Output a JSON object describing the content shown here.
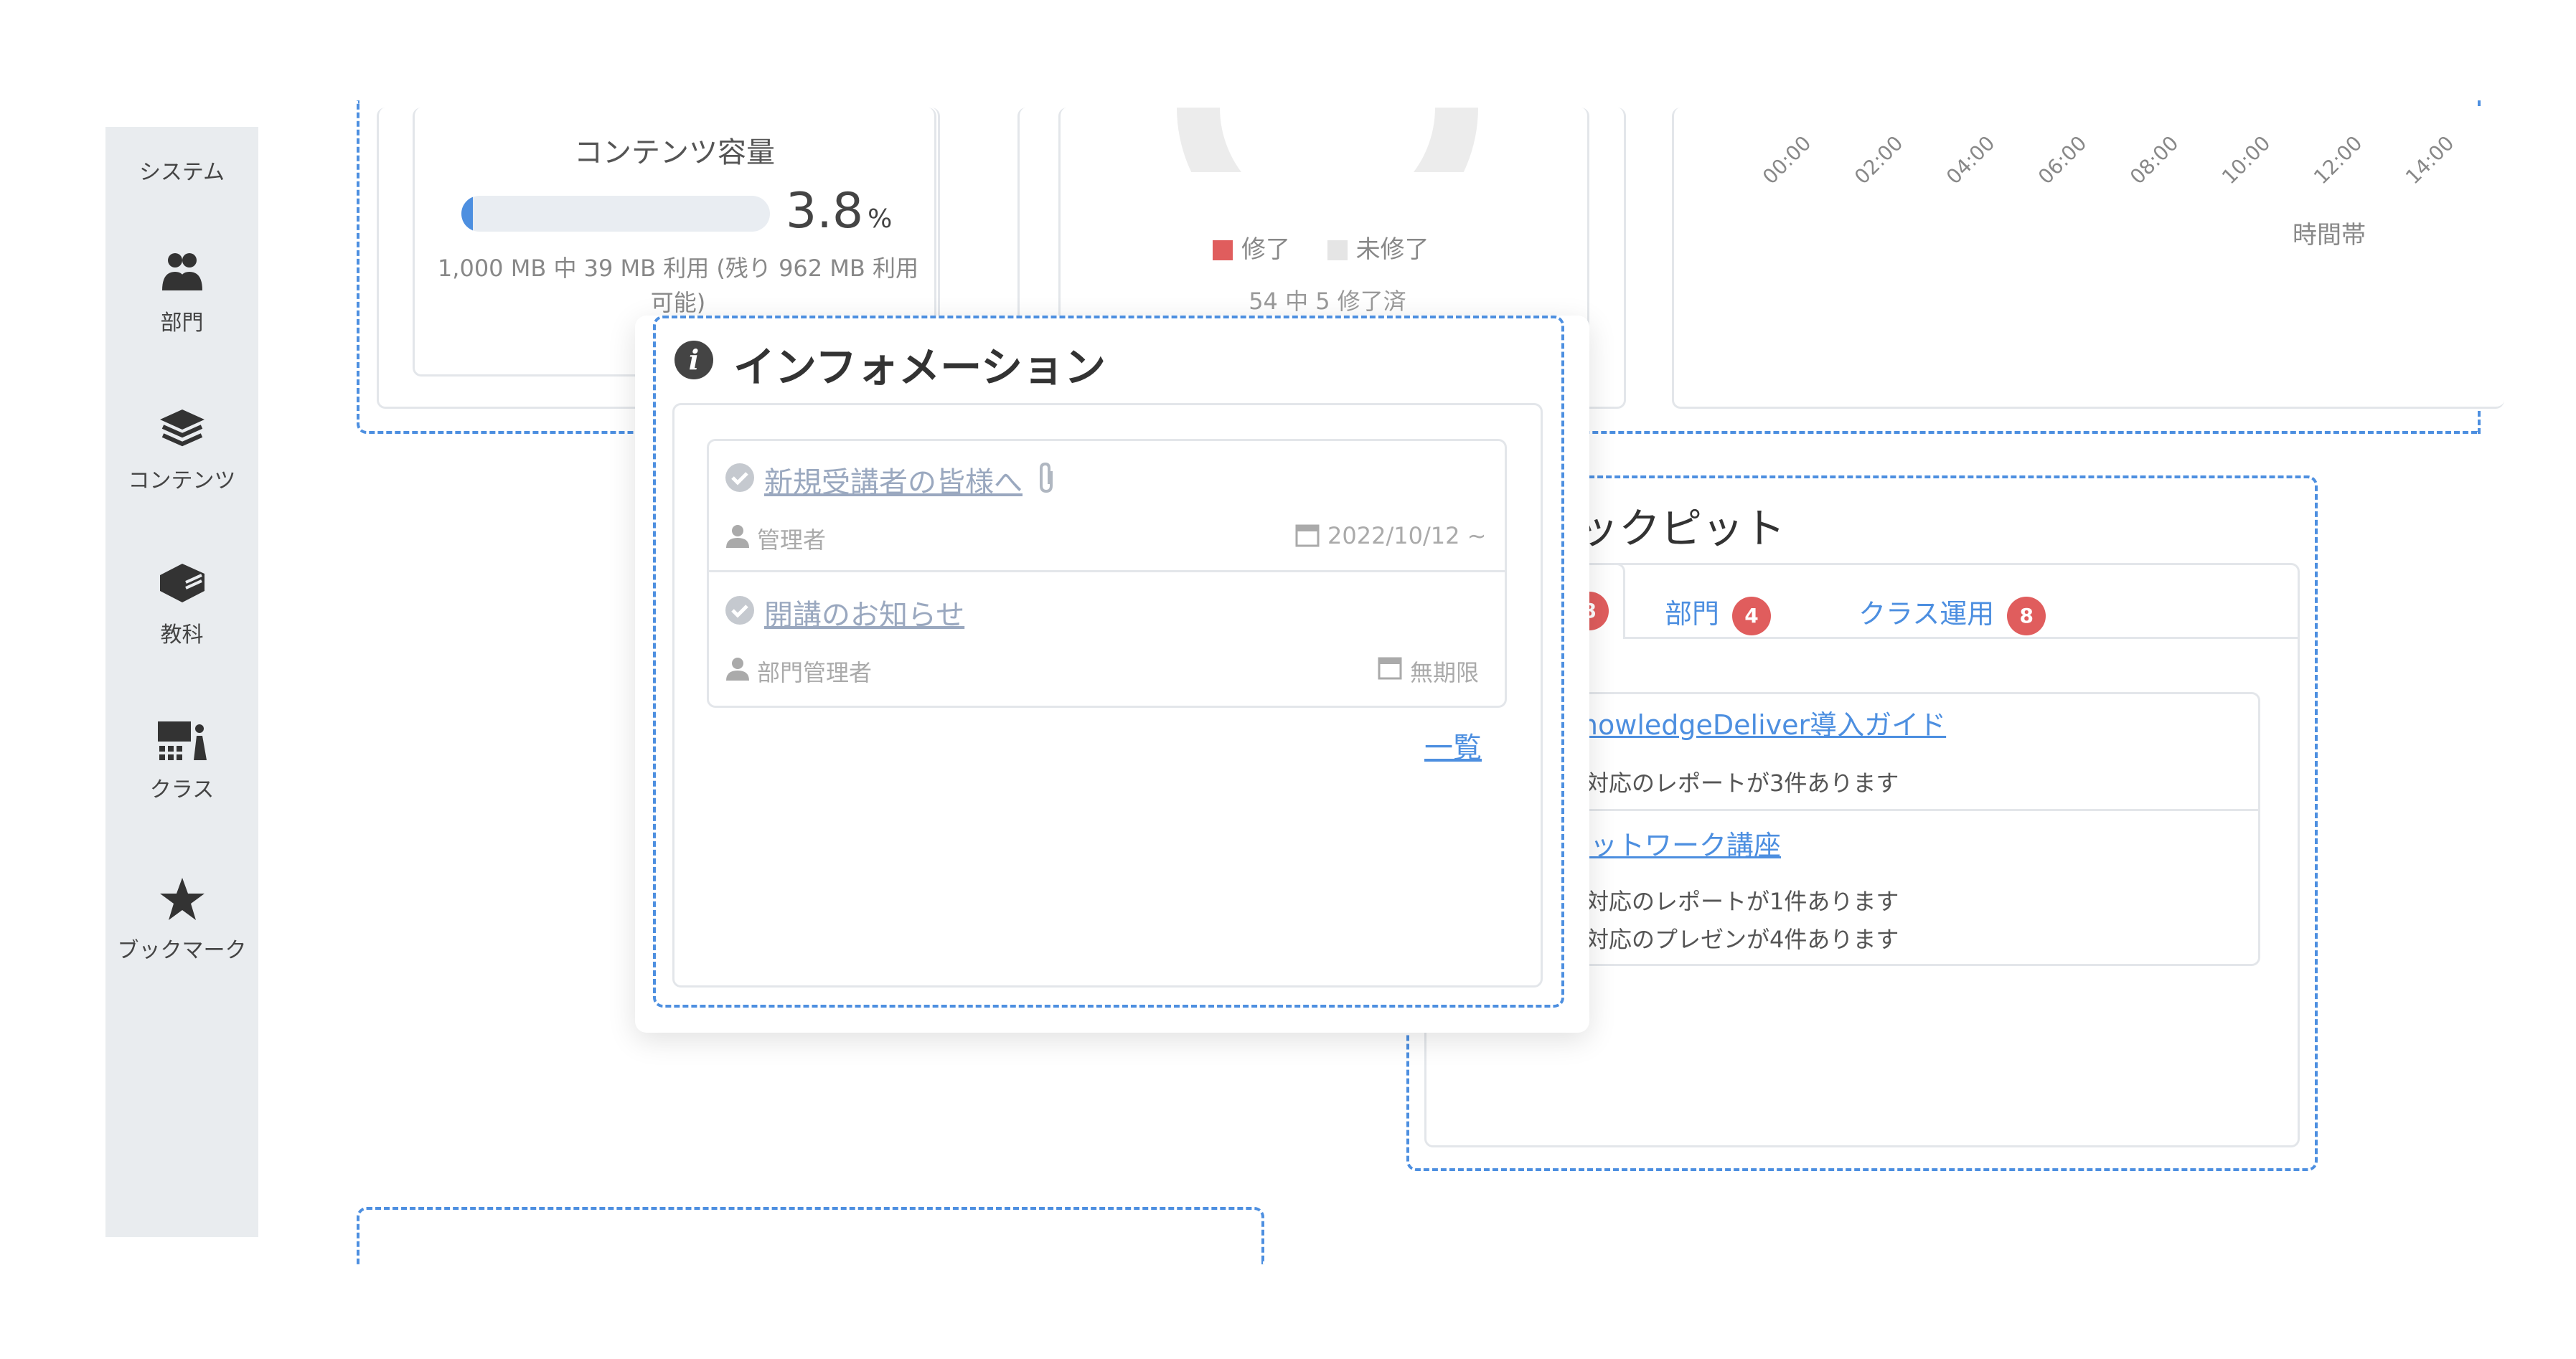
{
  "sidebar": {
    "items": [
      {
        "label": "システム"
      },
      {
        "label": "部門"
      },
      {
        "label": "コンテンツ"
      },
      {
        "label": "教科"
      },
      {
        "label": "クラス"
      },
      {
        "label": "ブックマーク"
      }
    ]
  },
  "storage": {
    "title": "コンテンツ容量",
    "percent_value": "3.8",
    "percent_unit": "%",
    "usage_fraction": 0.038,
    "usage_text": "1,000 MB 中 39 MB 利用 (残り 962 MB 利用可能)"
  },
  "completion": {
    "legend_completed": "修了",
    "legend_incomplete": "未修了",
    "summary": "54 中 5 修了済",
    "completed_color": "#e05d5d",
    "incomplete_color": "#e5e5e5"
  },
  "time_chart": {
    "ticks": [
      "00:00",
      "02:00",
      "04:00",
      "06:00",
      "08:00",
      "10:00",
      "12:00",
      "14:00"
    ],
    "axis_label": "時間帯"
  },
  "cockpit": {
    "title_fragment": "コックピット",
    "tabs": [
      {
        "label": "",
        "count": "8"
      },
      {
        "label": "部門",
        "count": "4"
      },
      {
        "label": "クラス運用",
        "count": "8"
      }
    ],
    "items": [
      {
        "title": "KnowledgeDeliver導入ガイド",
        "notes": [
          "未対応のレポートが3件あります"
        ]
      },
      {
        "title": "ネットワーク講座",
        "notes": [
          "未対応のレポートが1件あります",
          "未対応のプレゼンが4件あります"
        ]
      }
    ]
  },
  "information": {
    "title": "インフォメーション",
    "items": [
      {
        "title": "新規受講者の皆様へ",
        "author": "管理者",
        "date": "2022/10/12 ~"
      },
      {
        "title": "開講のお知らせ",
        "author": "部門管理者",
        "date": "無期限"
      }
    ],
    "more_link": "一覧"
  },
  "colors": {
    "accent": "#4d8fe0",
    "badge": "#e05d5d",
    "sidebar_bg": "#e9ecef"
  }
}
